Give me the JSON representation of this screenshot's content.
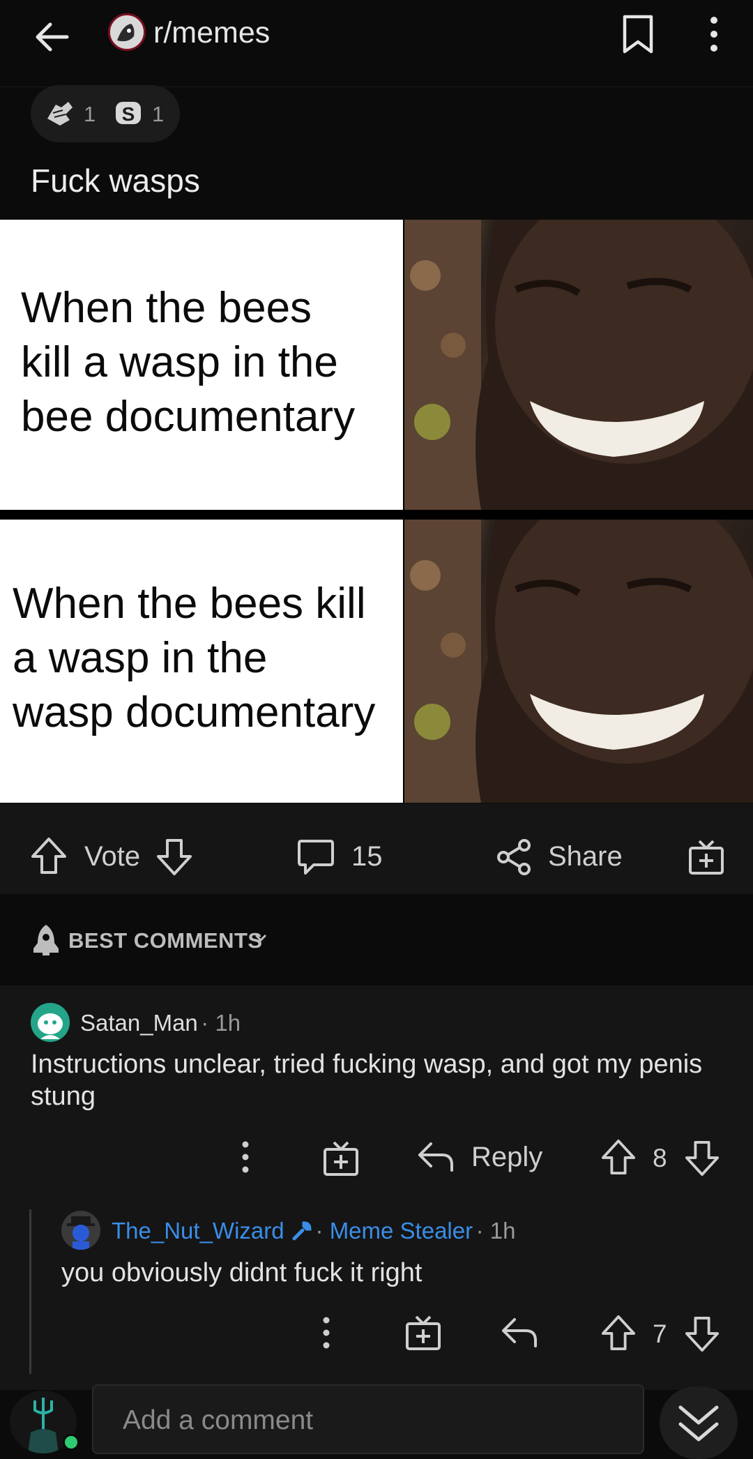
{
  "header": {
    "subreddit": "r/memes"
  },
  "awards": [
    {
      "icon": "hands-award-icon",
      "count": "1"
    },
    {
      "icon": "coin-award-icon",
      "count": "1"
    }
  ],
  "post": {
    "title": "Fuck wasps",
    "meme": {
      "panel_top": "When the bees\nkill a wasp in the\nbee documentary",
      "panel_bottom": "When the bees kill\na wasp in the\nwasp documentary"
    }
  },
  "actions": {
    "vote_label": "Vote",
    "comment_count": "15",
    "share_label": "Share"
  },
  "sort": {
    "label": "BEST COMMENTS"
  },
  "comments": [
    {
      "user": "Satan_Man",
      "time": "1h",
      "body": "Instructions unclear, tried fucking wasp, and got my penis stung",
      "reply_label": "Reply",
      "score": "8"
    },
    {
      "user": "The_Nut_Wizard",
      "flair": "Meme Stealer",
      "time": "1h",
      "body": "you obviously didnt fuck it right",
      "score": "7"
    }
  ],
  "composer": {
    "placeholder": "Add a comment"
  },
  "colors": {
    "background": "#0b0b0b",
    "surface": "#151515",
    "mod_blue": "#3a8ee8"
  }
}
